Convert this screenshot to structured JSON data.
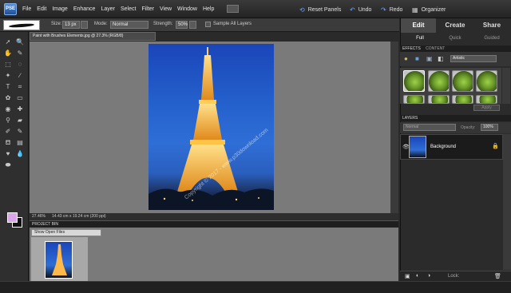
{
  "app": {
    "logo": "PSE",
    "accent": "#4a86d8"
  },
  "menu": [
    "File",
    "Edit",
    "Image",
    "Enhance",
    "Layer",
    "Select",
    "Filter",
    "View",
    "Window",
    "Help"
  ],
  "topbar": {
    "reset": "Reset Panels",
    "undo": "Undo",
    "redo": "Redo",
    "organizer": "Organizer"
  },
  "options": {
    "size_label": "Size:",
    "size_value": "13 px",
    "mode_label": "Mode:",
    "mode_value": "Normal",
    "strength_label": "Strength:",
    "strength_value": "50%",
    "sample_label": "Sample All Layers"
  },
  "document": {
    "tab": "Paint with Brushes Elements.jpg @ 27.3% (RGB/8)",
    "close": "×",
    "zoom": "27.46%",
    "info": "14.43 cm x 19.24 cm (200 ppi)"
  },
  "watermark": "Copyright © 2017 - www.p30download.com",
  "bin": {
    "title": "PROJECT BIN",
    "select": "Show Open Files"
  },
  "panel": {
    "tabs": [
      "Edit",
      "Create",
      "Share"
    ],
    "subtabs": [
      "Full",
      "Quick",
      "Guided"
    ],
    "effects_tabs": [
      "EFFECTS",
      "CONTENT"
    ],
    "effects_filter": "Artistic",
    "apply": "Apply",
    "layers_title": "LAYERS",
    "blend": "Normal",
    "opacity_label": "Opacity:",
    "opacity_value": "100%",
    "layer_name": "Background",
    "lock_label": "Lock:"
  }
}
